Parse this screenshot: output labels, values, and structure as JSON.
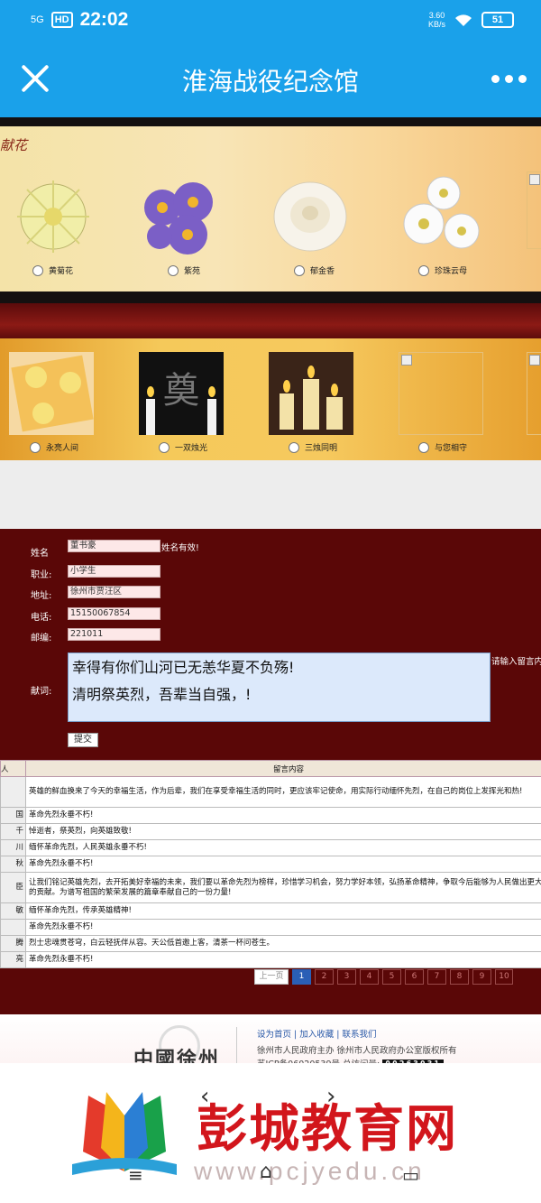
{
  "status": {
    "network": "5G",
    "signal": "ᴵᴵᴵ",
    "hd": "HD",
    "time": "22:02",
    "speed_value": "3.60",
    "speed_unit": "KB/s",
    "battery": "51"
  },
  "nav": {
    "title": "淮海战役纪念馆"
  },
  "flowers": {
    "header": "献花",
    "options": [
      {
        "label": "黄菊花"
      },
      {
        "label": "紫苑"
      },
      {
        "label": "郁金香"
      },
      {
        "label": "珍珠云母"
      }
    ]
  },
  "candles": {
    "options": [
      {
        "label": "永亮人间"
      },
      {
        "label": "一双烛光"
      },
      {
        "label": "三烛同明"
      },
      {
        "label": "与您相守"
      }
    ],
    "tile2_text": "奠"
  },
  "form": {
    "name_label": "姓名",
    "name_value": "董书豪",
    "name_hint": "姓名有效!",
    "job_label": "职业:",
    "job_value": "小学生",
    "addr_label": "地址:",
    "addr_value": "徐州市贾汪区",
    "phone_label": "电话:",
    "phone_value": "15150067854",
    "zip_label": "邮编:",
    "zip_value": "221011",
    "msg_label": "献词:",
    "msg_line1": "幸得有你们山河已无恙华夏不负殇!",
    "msg_line2": "清明祭英烈，吾辈当自强，!",
    "msg_hint": "请输入留言内",
    "submit": "提交"
  },
  "table": {
    "col1": "人",
    "col2": "留言内容",
    "rows": [
      {
        "n": "",
        "c": "英雄的鲜血换来了今天的幸福生活，作为后辈，我们在享受幸福生活的同时，更应该牢记使命，用实际行动缅怀先烈，在自己的岗位上发挥光和热!"
      },
      {
        "n": "国",
        "c": "革命先烈永垂不朽!"
      },
      {
        "n": "千",
        "c": "悼逝者，祭英烈，向英雄致敬!"
      },
      {
        "n": "川",
        "c": "缅怀革命先烈，人民英雄永垂不朽!"
      },
      {
        "n": "秋",
        "c": "革命先烈永垂不朽!"
      },
      {
        "n": "臣",
        "c": "让我们铭记英雄先烈，去开拓美好幸福的未来，我们要以革命先烈为榜样，珍惜学习机会，努力学好本领，弘扬革命精神，争取今后能够为人民做出更大的贡献。为谱写祖国的繁荣发展的篇章奉献自己的一份力量!"
      },
      {
        "n": "敏",
        "c": "缅怀革命先烈，传承英雄精神!"
      },
      {
        "n": "",
        "c": "革命先烈永垂不朽!"
      },
      {
        "n": "腾",
        "c": "烈士忠魂贯苍穹，白云轻抚伴从容。天公低首邀上客，清茶一杯问苍生。"
      },
      {
        "n": "亮",
        "c": "革命先烈永垂不朽!"
      }
    ],
    "pager": {
      "prev": "上一页",
      "pages": [
        "1",
        "2",
        "3",
        "4",
        "5",
        "6",
        "7",
        "8",
        "9",
        "10"
      ],
      "active": "1"
    }
  },
  "footer": {
    "links": "设为首页 | 加入收藏 | 联系我们",
    "line2": "徐州市人民政府主办  徐州市人民政府办公室版权所有",
    "line3_prefix": "苏ICP备06020539号  总访问量:",
    "counter": "00263031",
    "logo_text": "中國徐州"
  },
  "watermark": {
    "brand": "彭城教育网",
    "url": "www.pcjyedu.cn"
  },
  "colors": {
    "header_blue": "#1aa1ea",
    "form_bg": "#5a0707",
    "active_page": "#2a5fb6",
    "brand_red": "#d2161c"
  }
}
